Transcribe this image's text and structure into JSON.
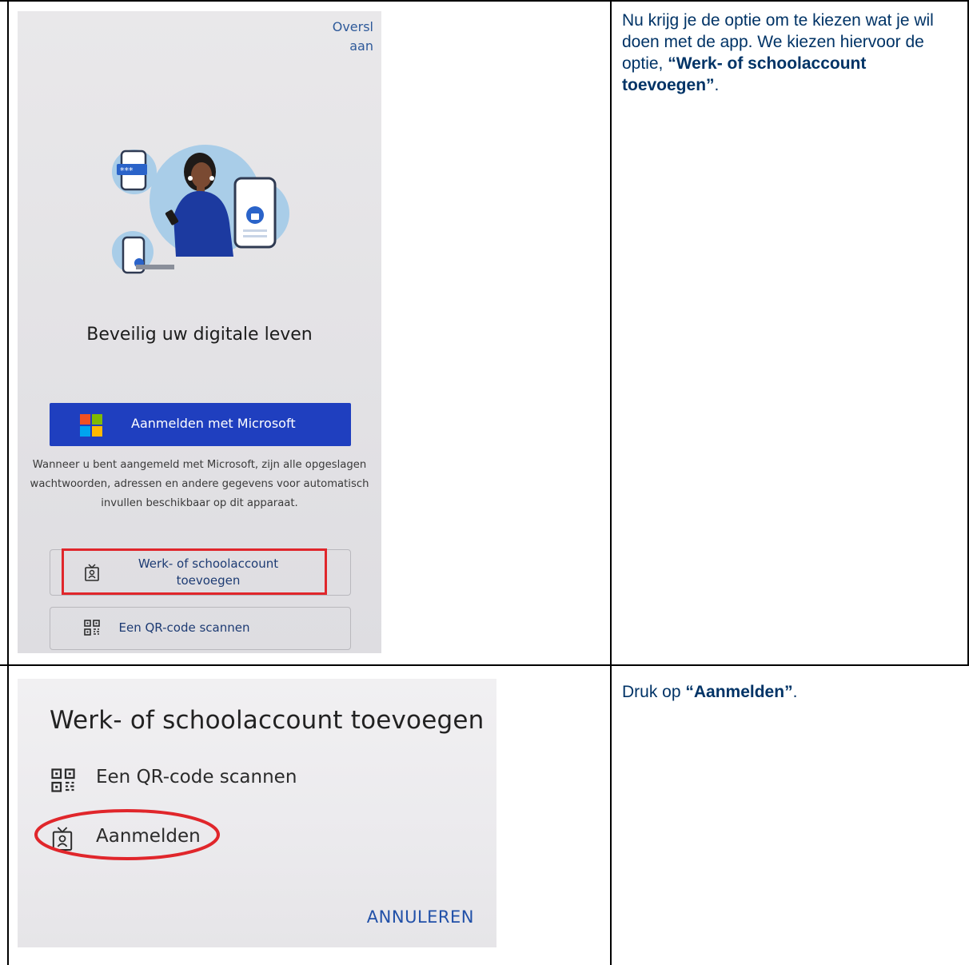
{
  "row1": {
    "instruction_text": "Nu krijg je de optie om te kiezen wat je wil doen met de app. We kiezen hiervoor de optie,",
    "instruction_bold": "“Werk- of schoolaccount toevoegen”",
    "instruction_end": ".",
    "screen": {
      "skip_label": "Oversl aan",
      "title": "Beveilig uw digitale leven",
      "ms_button_label": "Aanmelden met Microsoft",
      "description": "Wanneer u bent aangemeld met Microsoft, zijn alle opgeslagen wachtwoorden, adressen en andere gegevens voor automatisch invullen beschikbaar op dit apparaat.",
      "work_button_label": "Werk- of schoolaccount toevoegen",
      "qr_button_label": "Een QR-code scannen",
      "hero_password_text": "***"
    }
  },
  "row2": {
    "instruction_text": "Druk op",
    "instruction_bold": "“Aanmelden”",
    "instruction_end": ".",
    "screen": {
      "title": "Werk- of schoolaccount toevoegen",
      "qr_option_label": "Een QR-code scannen",
      "signin_option_label": "Aanmelden",
      "cancel_label": "ANNULEREN"
    }
  },
  "colors": {
    "ms_blue": "#1f3fbf",
    "highlight_red": "#e0262b",
    "instruction_text": "#003366",
    "link_blue": "#2150a8"
  }
}
